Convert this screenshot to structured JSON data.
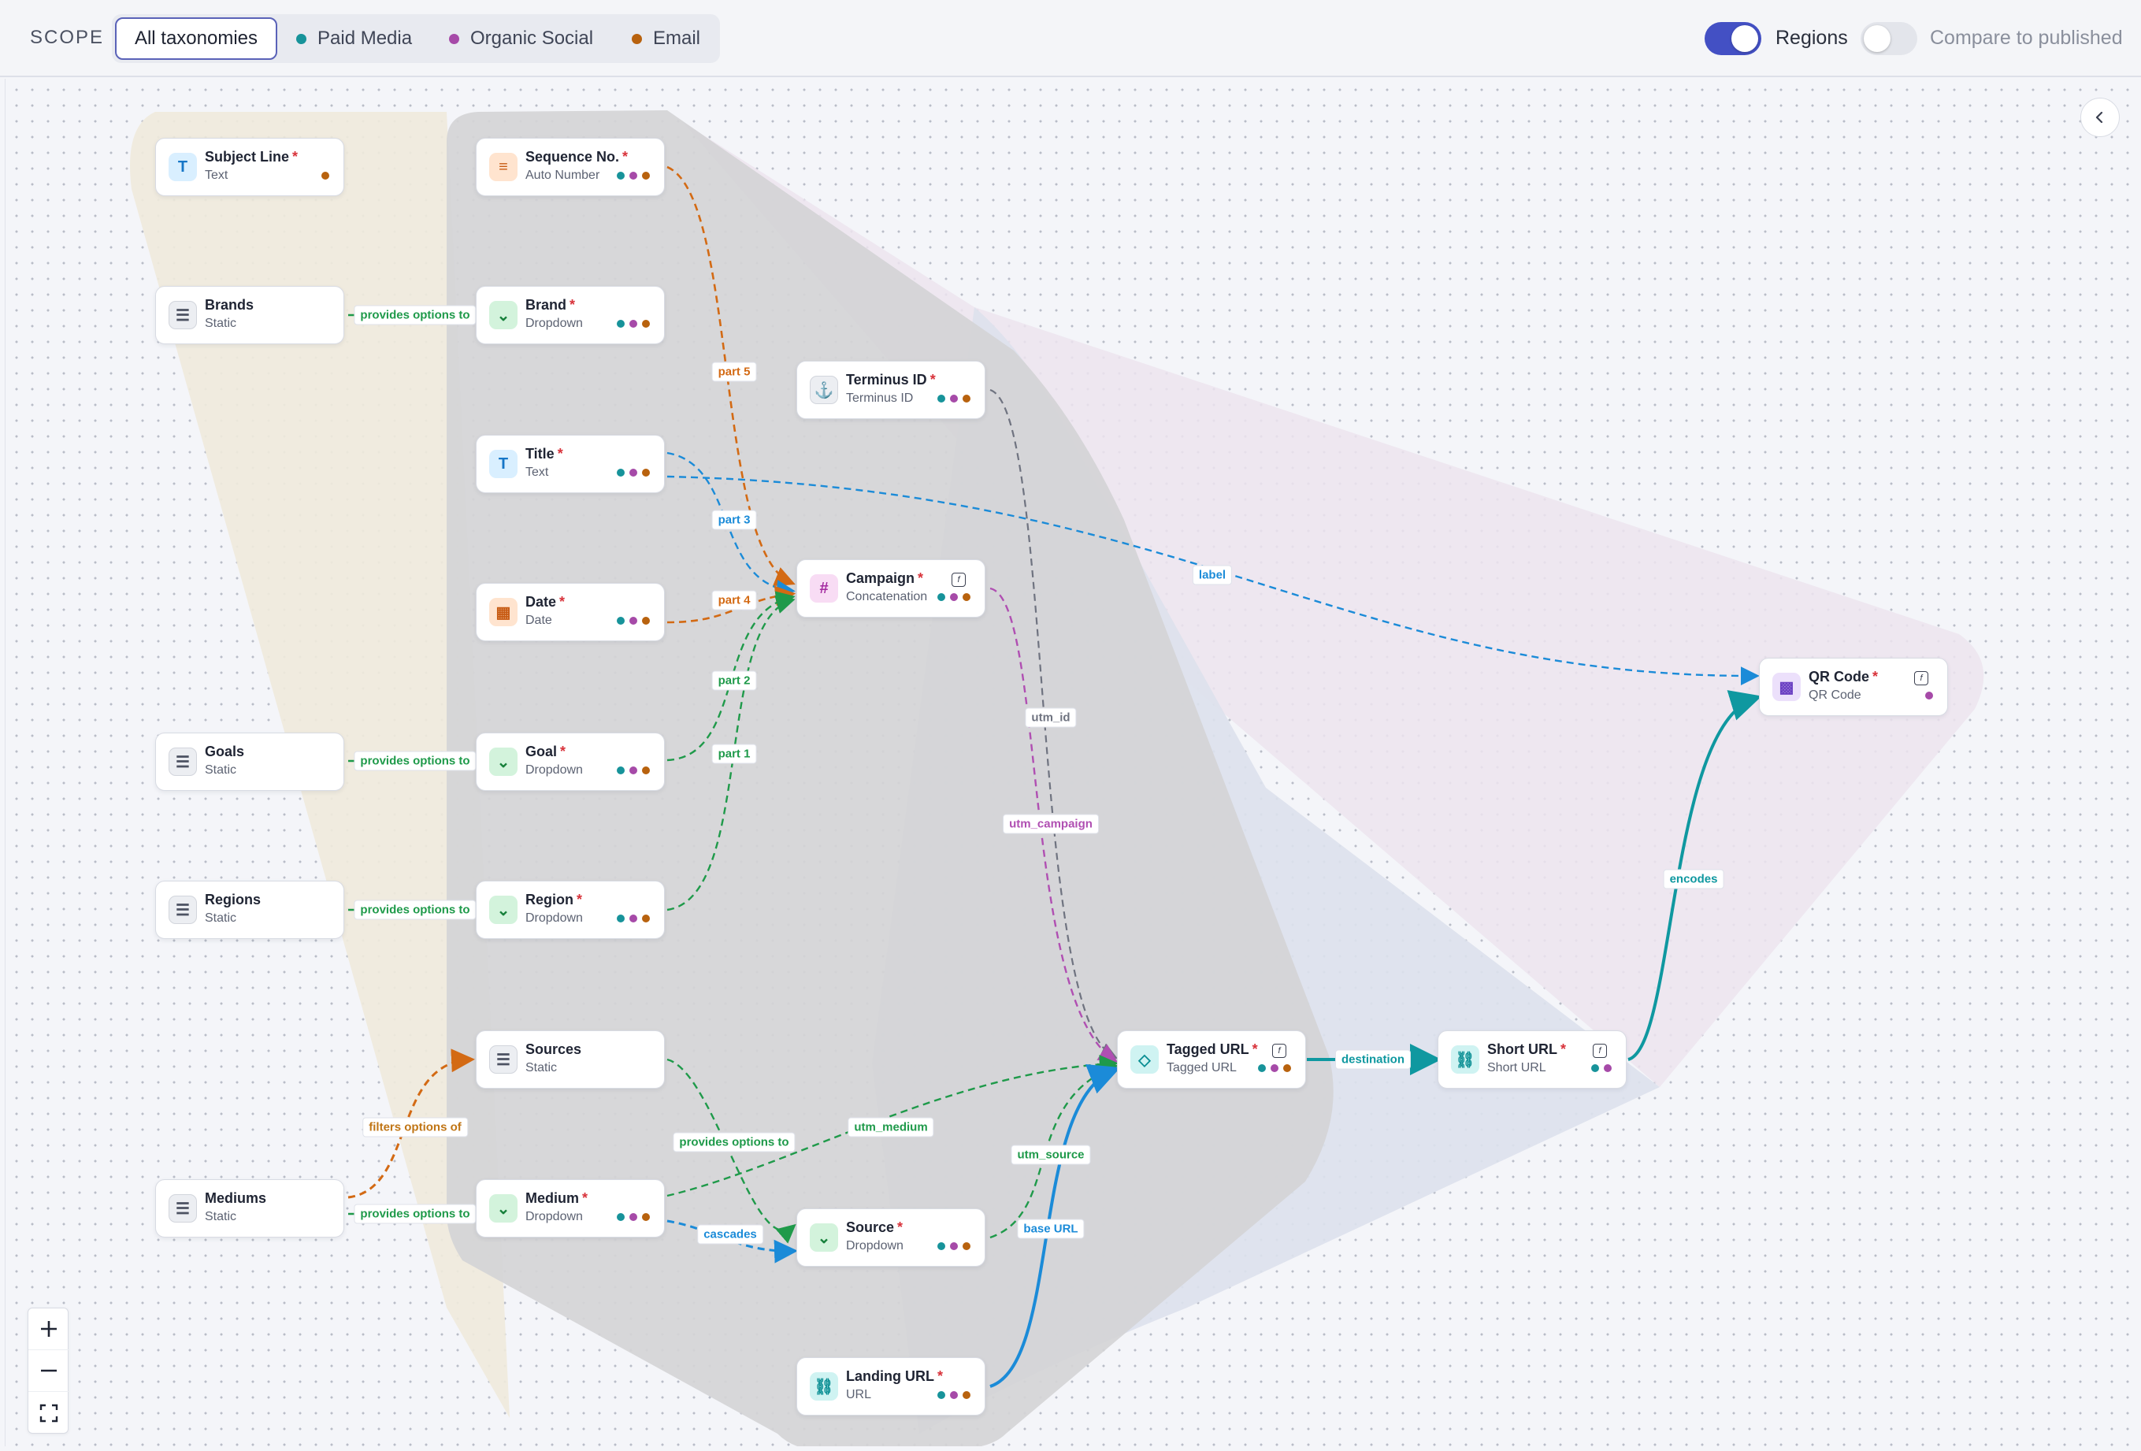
{
  "header": {
    "scope_label": "SCOPE",
    "chips": [
      {
        "label": "All taxonomies",
        "color": null
      },
      {
        "label": "Paid Media",
        "color": "#17939a"
      },
      {
        "label": "Organic Social",
        "color": "#a64aa8"
      },
      {
        "label": "Email",
        "color": "#b8620e"
      }
    ],
    "regions_label": "Regions",
    "regions_on": true,
    "compare_label": "Compare to published",
    "compare_on": false
  },
  "colors": {
    "paid": "#17939a",
    "organic": "#a64aa8",
    "email": "#b8620e",
    "edge_green": "#1f9a4a",
    "edge_orange": "#d36a14",
    "edge_blue": "#1b8bd8",
    "edge_pink": "#b04fb2",
    "edge_gray": "#6f7380",
    "edge_teal": "#0f98a0"
  },
  "nodes": {
    "subject_line": {
      "title": "Subject Line",
      "required": "*",
      "type": "Text",
      "icon": "text-icon"
    },
    "brands": {
      "title": "Brands",
      "type": "Static",
      "icon": "list-icon"
    },
    "goals": {
      "title": "Goals",
      "type": "Static",
      "icon": "list-icon"
    },
    "regions": {
      "title": "Regions",
      "type": "Static",
      "icon": "list-icon"
    },
    "mediums": {
      "title": "Mediums",
      "type": "Static",
      "icon": "list-icon"
    },
    "sequence_no": {
      "title": "Sequence No.",
      "required": "*",
      "type": "Auto Number",
      "icon": "numbered-list-icon"
    },
    "brand": {
      "title": "Brand",
      "required": "*",
      "type": "Dropdown",
      "icon": "chevron-down-icon"
    },
    "title": {
      "title": "Title",
      "required": "*",
      "type": "Text",
      "icon": "text-icon"
    },
    "date": {
      "title": "Date",
      "required": "*",
      "type": "Date",
      "icon": "calendar-icon"
    },
    "goal": {
      "title": "Goal",
      "required": "*",
      "type": "Dropdown",
      "icon": "chevron-down-icon"
    },
    "region": {
      "title": "Region",
      "required": "*",
      "type": "Dropdown",
      "icon": "chevron-down-icon"
    },
    "sources": {
      "title": "Sources",
      "type": "Static",
      "icon": "list-icon"
    },
    "medium": {
      "title": "Medium",
      "required": "*",
      "type": "Dropdown",
      "icon": "chevron-down-icon"
    },
    "terminus_id": {
      "title": "Terminus ID",
      "required": "*",
      "type": "Terminus ID",
      "icon": "anchor-icon"
    },
    "campaign": {
      "title": "Campaign",
      "required": "*",
      "type": "Concatenation",
      "icon": "hash-icon"
    },
    "source": {
      "title": "Source",
      "required": "*",
      "type": "Dropdown",
      "icon": "chevron-down-icon"
    },
    "landing_url": {
      "title": "Landing URL",
      "required": "*",
      "type": "URL",
      "icon": "link-icon"
    },
    "tagged_url": {
      "title": "Tagged URL",
      "required": "*",
      "type": "Tagged URL",
      "icon": "tag-icon"
    },
    "short_url": {
      "title": "Short URL",
      "required": "*",
      "type": "Short URL",
      "icon": "link-icon"
    },
    "qr_code": {
      "title": "QR Code",
      "required": "*",
      "type": "QR Code",
      "icon": "qr-code-icon"
    }
  },
  "edge_labels": {
    "provides_options_to": "provides options to",
    "filters_options_of": "filters options of",
    "part1": "part 1",
    "part2": "part 2",
    "part3": "part 3",
    "part4": "part 4",
    "part5": "part 5",
    "label": "label",
    "utm_id": "utm_id",
    "utm_campaign": "utm_campaign",
    "utm_medium": "utm_medium",
    "utm_source": "utm_source",
    "cascades": "cascades",
    "base_url": "base URL",
    "destination": "destination",
    "encodes": "encodes"
  },
  "controls": {
    "zoom_in": "+",
    "zoom_out": "−"
  }
}
